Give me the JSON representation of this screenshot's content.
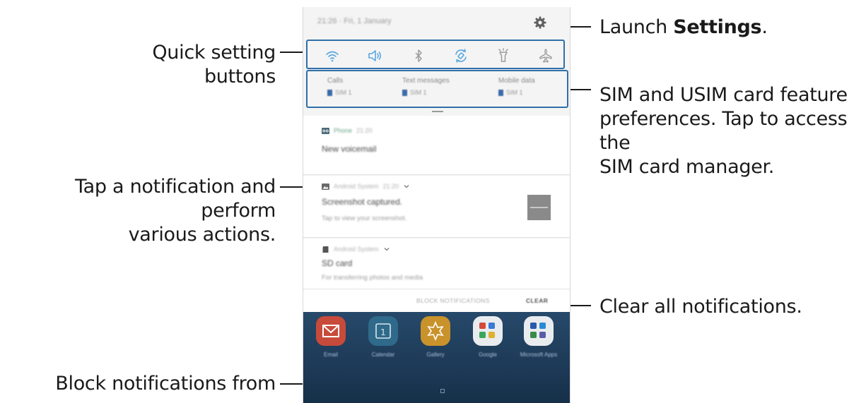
{
  "callouts": {
    "quick_settings": "Quick setting buttons",
    "launch_settings_prefix": "Launch ",
    "launch_settings_bold": "Settings",
    "launch_settings_suffix": ".",
    "sim_line1": "SIM and USIM card feature",
    "sim_line2": "preferences. Tap to access the",
    "sim_line3": "SIM card manager.",
    "tap_notif_line1": "Tap a notification and perform",
    "tap_notif_line2": "various actions.",
    "clear_all": "Clear all notifications.",
    "block": "Block notifications from apps."
  },
  "status": {
    "time_date": "21:26 · Fri, 1 January"
  },
  "quick_settings": [
    "wifi-icon",
    "sound-icon",
    "bluetooth-icon",
    "auto-rotate-icon",
    "flashlight-icon",
    "airplane-mode-icon"
  ],
  "sim_prefs": [
    {
      "title": "Calls",
      "sim": "SIM 1"
    },
    {
      "title": "Text messages",
      "sim": "SIM 1"
    },
    {
      "title": "Mobile data",
      "sim": "SIM 1"
    }
  ],
  "notifications": [
    {
      "app": "Phone",
      "time": "21:20",
      "title": "New voicemail",
      "sub": ""
    },
    {
      "app": "Android System",
      "time": "21:20",
      "title": "Screenshot captured.",
      "sub": "Tap to view your screenshot."
    },
    {
      "app": "Android System",
      "time": "",
      "title": "SD card",
      "sub": "For transferring photos and media"
    }
  ],
  "bottom_bar": {
    "block_label": "BLOCK NOTIFICATIONS",
    "clear_label": "CLEAR"
  },
  "home_apps": [
    {
      "name": "Email",
      "color": "#c84a3a"
    },
    {
      "name": "Calendar",
      "color": "#2f6a8a"
    },
    {
      "name": "Gallery",
      "color": "#c9922a"
    },
    {
      "name": "Google",
      "color": "#e9ecef"
    },
    {
      "name": "Microsoft Apps",
      "color": "#e9ecef"
    }
  ],
  "colors": {
    "highlight": "#2f6fa8",
    "quick_icon": "#5aa7e0"
  }
}
